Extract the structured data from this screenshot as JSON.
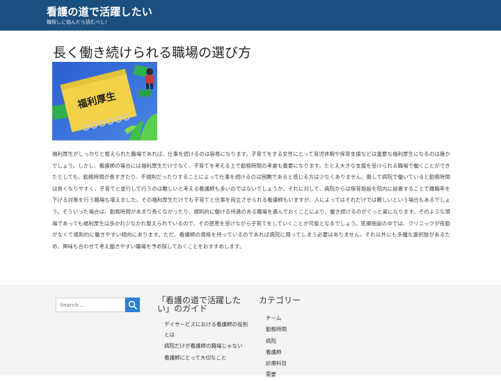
{
  "header": {
    "site_title": "看護の道で活躍したい",
    "tagline": "職探しに悩んだら読むべし！",
    "bg_color": "#1a4f7f"
  },
  "post": {
    "title": "長く働き続けられる職場の選び方",
    "image_caption": "福利厚生",
    "body": "福利厚生がしっかりと整えられた職場であれば、仕事を続けるのは容易になります。子育てをする女性にとって育児休暇や保育支援などは重要な福利厚生になるのは確かでしょう。しかし、看護師の場合には福利厚生だけでなく、子育てを考える上で勤務時間の考慮も重要になります。たとえ大きな支援を受けられる職場で働くことができたとしても、勤務時間が長すぎたり、不規則だったりすることによって仕事を続けるのは困難であると感じる方は少なくありません。概して病院で働いていると勤務時間は長くなりやすく、子育てと並行して行うのは難しいと考える看護師も多いのではないでしょうか。それに対して、病院からは保育施設を院内に設置することで離職率を下げる対策を行う職場も増えました。その福利厚生だけでも子育てと仕事を両立させられる看護師もいますが、人によってはそれだけでは難しいという場合もあるでしょう。そういった場合は、勤務時間があまり長くなかったり、規則的に働ける待遇のある職場を選んでおくことにより、働き続けるのがぐっと楽になります。そのような現場であっても福利厚生は多かれ少なかれ整えられているので、その恩恵を受けながら子育てをしていくことが可能となるでしょう。医療施設の中では、クリニックが夜勤がなくて規則的に働きやすい傾向にあります。ただ、看護師の資格を持っているのであれば病院に限ってしまう必要はありません。それ以外にも多種な選択肢があるため、興味も合わせて考え働きやすい職場を予め探しておくことをおすすめします。"
  },
  "footer": {
    "search": {
      "placeholder": "Search …",
      "button_icon": "search-icon",
      "button_color": "#2b7fd6"
    },
    "guide_widget": {
      "title": "「看護の道で活躍したい」のガイド",
      "items": [
        "デイサービスにおける看護師の役割とは",
        "病院だけが看護師の職場じゃない",
        "看護師にとって大切なこと"
      ]
    },
    "category_widget": {
      "title": "カテゴリー",
      "items": [
        "チーム",
        "勤務時間",
        "病院",
        "看護師",
        "診療科目",
        "需要"
      ]
    }
  }
}
